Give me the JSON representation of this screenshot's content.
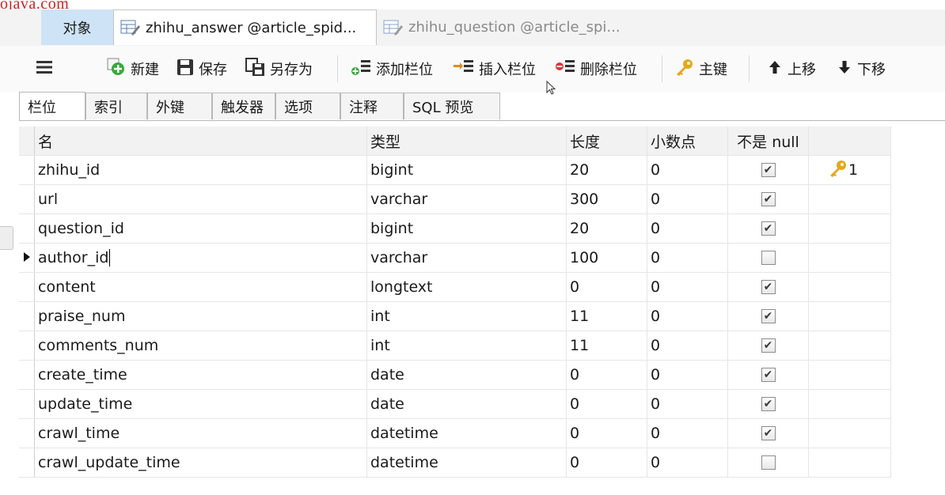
{
  "watermark": "ojava.com",
  "tabs": {
    "objects_label": "对象",
    "active_label": "zhihu_answer @article_spid...",
    "inactive_label": "zhihu_question @article_spi..."
  },
  "toolbar": {
    "new_label": "新建",
    "save_label": "保存",
    "save_as_label": "另存为",
    "add_column_label": "添加栏位",
    "insert_column_label": "插入栏位",
    "delete_column_label": "删除栏位",
    "primary_key_label": "主键",
    "move_up_label": "上移",
    "move_down_label": "下移"
  },
  "subtabs": [
    "栏位",
    "索引",
    "外键",
    "触发器",
    "选项",
    "注释",
    "SQL 预览"
  ],
  "columns": {
    "name": "名",
    "type": "类型",
    "length": "长度",
    "decimals": "小数点",
    "not_null": "不是 null"
  },
  "rows": [
    {
      "name": "zhihu_id",
      "type": "bigint",
      "length": "20",
      "decimals": "0",
      "not_null": true,
      "key": "1"
    },
    {
      "name": "url",
      "type": "varchar",
      "length": "300",
      "decimals": "0",
      "not_null": true,
      "key": ""
    },
    {
      "name": "question_id",
      "type": "bigint",
      "length": "20",
      "decimals": "0",
      "not_null": true,
      "key": ""
    },
    {
      "name": "author_id",
      "type": "varchar",
      "length": "100",
      "decimals": "0",
      "not_null": false,
      "key": "",
      "current": true
    },
    {
      "name": "content",
      "type": "longtext",
      "length": "0",
      "decimals": "0",
      "not_null": true,
      "key": ""
    },
    {
      "name": "praise_num",
      "type": "int",
      "length": "11",
      "decimals": "0",
      "not_null": true,
      "key": ""
    },
    {
      "name": "comments_num",
      "type": "int",
      "length": "11",
      "decimals": "0",
      "not_null": true,
      "key": ""
    },
    {
      "name": "create_time",
      "type": "date",
      "length": "0",
      "decimals": "0",
      "not_null": true,
      "key": ""
    },
    {
      "name": "update_time",
      "type": "date",
      "length": "0",
      "decimals": "0",
      "not_null": true,
      "key": ""
    },
    {
      "name": "crawl_time",
      "type": "datetime",
      "length": "0",
      "decimals": "0",
      "not_null": true,
      "key": ""
    },
    {
      "name": "crawl_update_time",
      "type": "datetime",
      "length": "0",
      "decimals": "0",
      "not_null": false,
      "key": ""
    }
  ],
  "icons": {
    "menu": "hamburger-icon",
    "new": "add-icon",
    "save": "save-icon",
    "save_as": "save-as-icon",
    "add_column": "add-column-icon",
    "insert_column": "insert-column-icon",
    "delete_column": "delete-column-icon",
    "primary_key": "key-icon",
    "move_up": "arrow-up-icon",
    "move_down": "arrow-down-icon"
  },
  "colors": {
    "objects_tab_bg": "#cfe3f6",
    "key_gold": "#e2a91c",
    "add_green": "#3aa83a",
    "delete_red": "#d23a3a"
  }
}
